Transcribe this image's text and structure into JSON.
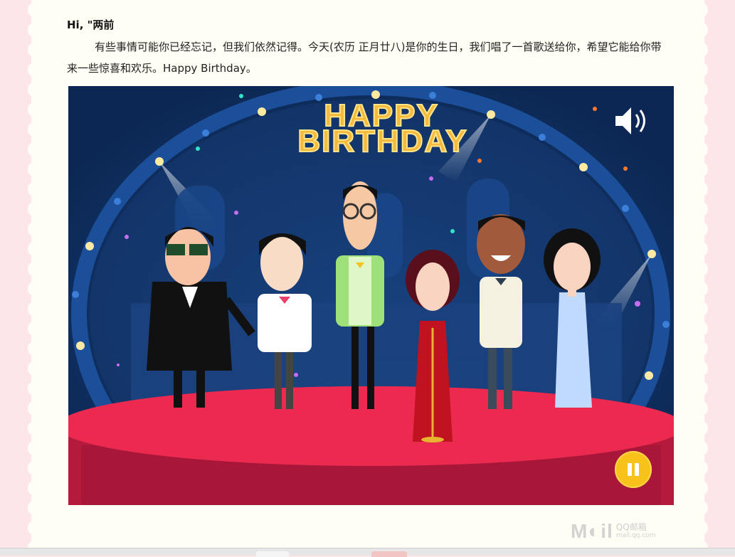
{
  "email": {
    "greeting": "Hi, \"两前",
    "body": "有些事情可能你已经忘记，但我们依然记得。今天(农历 正月廿八)是你的生日，我们唱了一首歌送给你，希望它能给你带来一些惊喜和欢乐。Happy Birthday。"
  },
  "video": {
    "title_line1": "HAPPY",
    "title_line2": "BIRTHDAY",
    "sound_icon": "speaker-volume-icon",
    "pause_icon": "pause-icon"
  },
  "watermark": {
    "logo": "M◐il",
    "brand": "QQ邮箱",
    "domain": "mail.qq.com"
  },
  "colors": {
    "page_bg": "#fde6ea",
    "card_bg": "#fffef4",
    "stage_red": "#e8274b",
    "night_blue": "#0d2a5a",
    "pause_yellow": "#f7c21a"
  }
}
